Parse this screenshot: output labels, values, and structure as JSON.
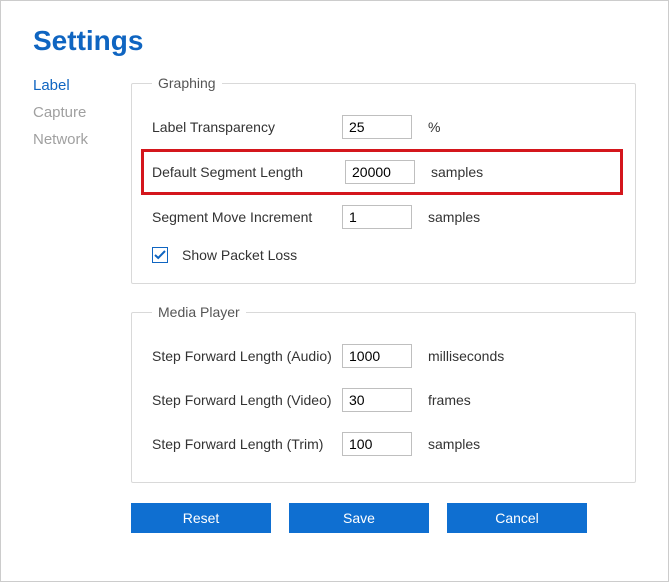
{
  "title": "Settings",
  "sidebar": {
    "items": [
      {
        "label": "Label",
        "active": true
      },
      {
        "label": "Capture",
        "active": false
      },
      {
        "label": "Network",
        "active": false
      }
    ]
  },
  "groups": {
    "graphing": {
      "legend": "Graphing",
      "labelTransparency": {
        "label": "Label Transparency",
        "value": "25",
        "unit": "%"
      },
      "defaultSegmentLength": {
        "label": "Default Segment Length",
        "value": "20000",
        "unit": "samples"
      },
      "segmentMoveIncrement": {
        "label": "Segment Move Increment",
        "value": "1",
        "unit": "samples"
      },
      "showPacketLoss": {
        "label": "Show Packet Loss",
        "checked": true
      }
    },
    "mediaPlayer": {
      "legend": "Media Player",
      "stepForwardAudio": {
        "label": "Step Forward Length (Audio)",
        "value": "1000",
        "unit": "milliseconds"
      },
      "stepForwardVideo": {
        "label": "Step Forward Length (Video)",
        "value": "30",
        "unit": "frames"
      },
      "stepForwardTrim": {
        "label": "Step Forward Length (Trim)",
        "value": "100",
        "unit": "samples"
      }
    }
  },
  "buttons": {
    "reset": "Reset",
    "save": "Save",
    "cancel": "Cancel"
  }
}
